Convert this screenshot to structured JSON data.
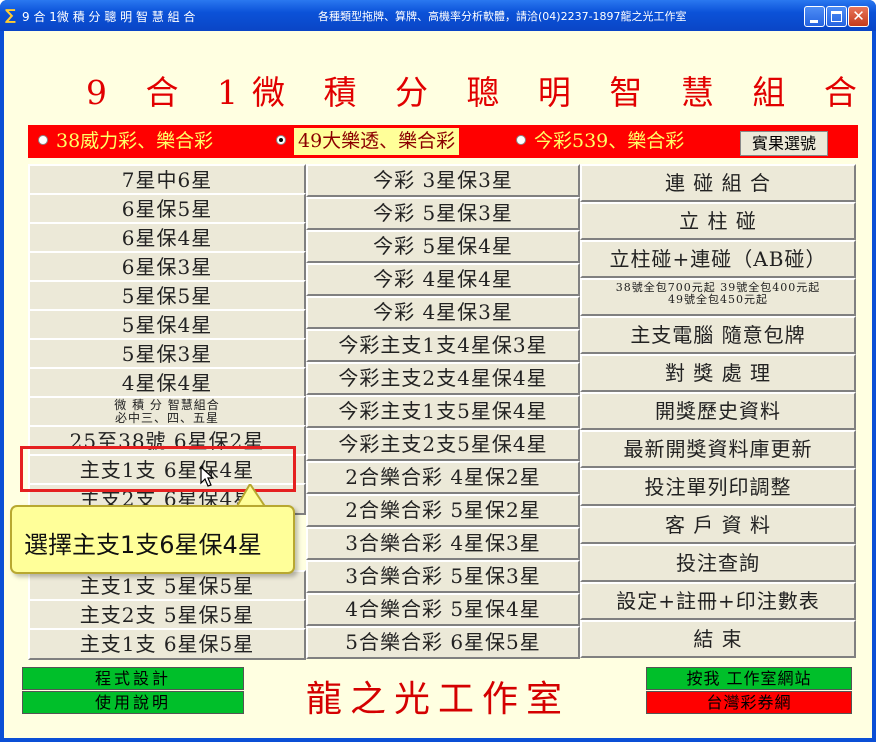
{
  "window": {
    "title": "9 合 1微 積 分 聰 明 智 慧 組 合",
    "ad_text": "各種類型拖牌、算牌、高機率分析軟體，請洽(04)2237-1897龍之光工作室"
  },
  "header": {
    "main_title": "9 合 1微 積 分 聰 明 智 慧 組 合"
  },
  "tabs": [
    {
      "label": "38威力彩、樂合彩",
      "selected": false
    },
    {
      "label": "49大樂透、樂合彩",
      "selected": true
    },
    {
      "label": "今彩539、樂合彩",
      "selected": false
    }
  ],
  "result_button": "賓果選號",
  "columns": {
    "left": [
      "7星中6星",
      "6星保5星",
      "6星保4星",
      "6星保3星",
      "5星保5星",
      "5星保4星",
      "5星保3星",
      "4星保4星",
      {
        "line1": "微 積 分 智慧組合",
        "line2": "必中三、四、五星"
      },
      "25至38號 6星保2星",
      "主支1支 6星保4星",
      "主支2支 6星保4星",
      "主支1支 5星保5星",
      "主支2支 5星保5星",
      "主支1支 6星保5星"
    ],
    "middle": [
      "今彩 3星保3星",
      "今彩 5星保3星",
      "今彩 5星保4星",
      "今彩 4星保4星",
      "今彩 4星保3星",
      "今彩主支1支4星保3星",
      "今彩主支2支4星保4星",
      "今彩主支1支5星保4星",
      "今彩主支2支5星保4星",
      "2合樂合彩 4星保2星",
      "2合樂合彩 5星保2星",
      "3合樂合彩 4星保3星",
      "3合樂合彩 5星保3星",
      "4合樂合彩 5星保4星",
      "5合樂合彩 6星保5星"
    ],
    "right": [
      "連 碰 組 合",
      "立 柱 碰",
      "立柱碰+連碰（AB碰）",
      {
        "line1": "38號全包700元起 39號全包400元起",
        "line2": "49號全包450元起"
      },
      "主支電腦 隨意包牌",
      "對 獎 處 理",
      "開獎歷史資料",
      "最新開獎資料庫更新",
      "投注單列印調整",
      "客 戶 資 料",
      "投注查詢",
      "設定+註冊+印注數表",
      "結 束"
    ]
  },
  "footer": {
    "program_design": "程式設計",
    "manual": "使用說明",
    "studio_name": "龍之光工作室",
    "website_button": "按我 工作室網站",
    "taiwan_lottery": "台灣彩券網"
  },
  "callout": {
    "text": "選擇主支1支6星保4星"
  },
  "colors": {
    "title_red": "#e10000",
    "tab_bar": "#ff0000",
    "tab_text": "#ffff66",
    "green_button": "#00bf2a",
    "red_button": "#ff0000",
    "client_bg": "#ffffe1",
    "callout_bg": "#ffff99"
  }
}
